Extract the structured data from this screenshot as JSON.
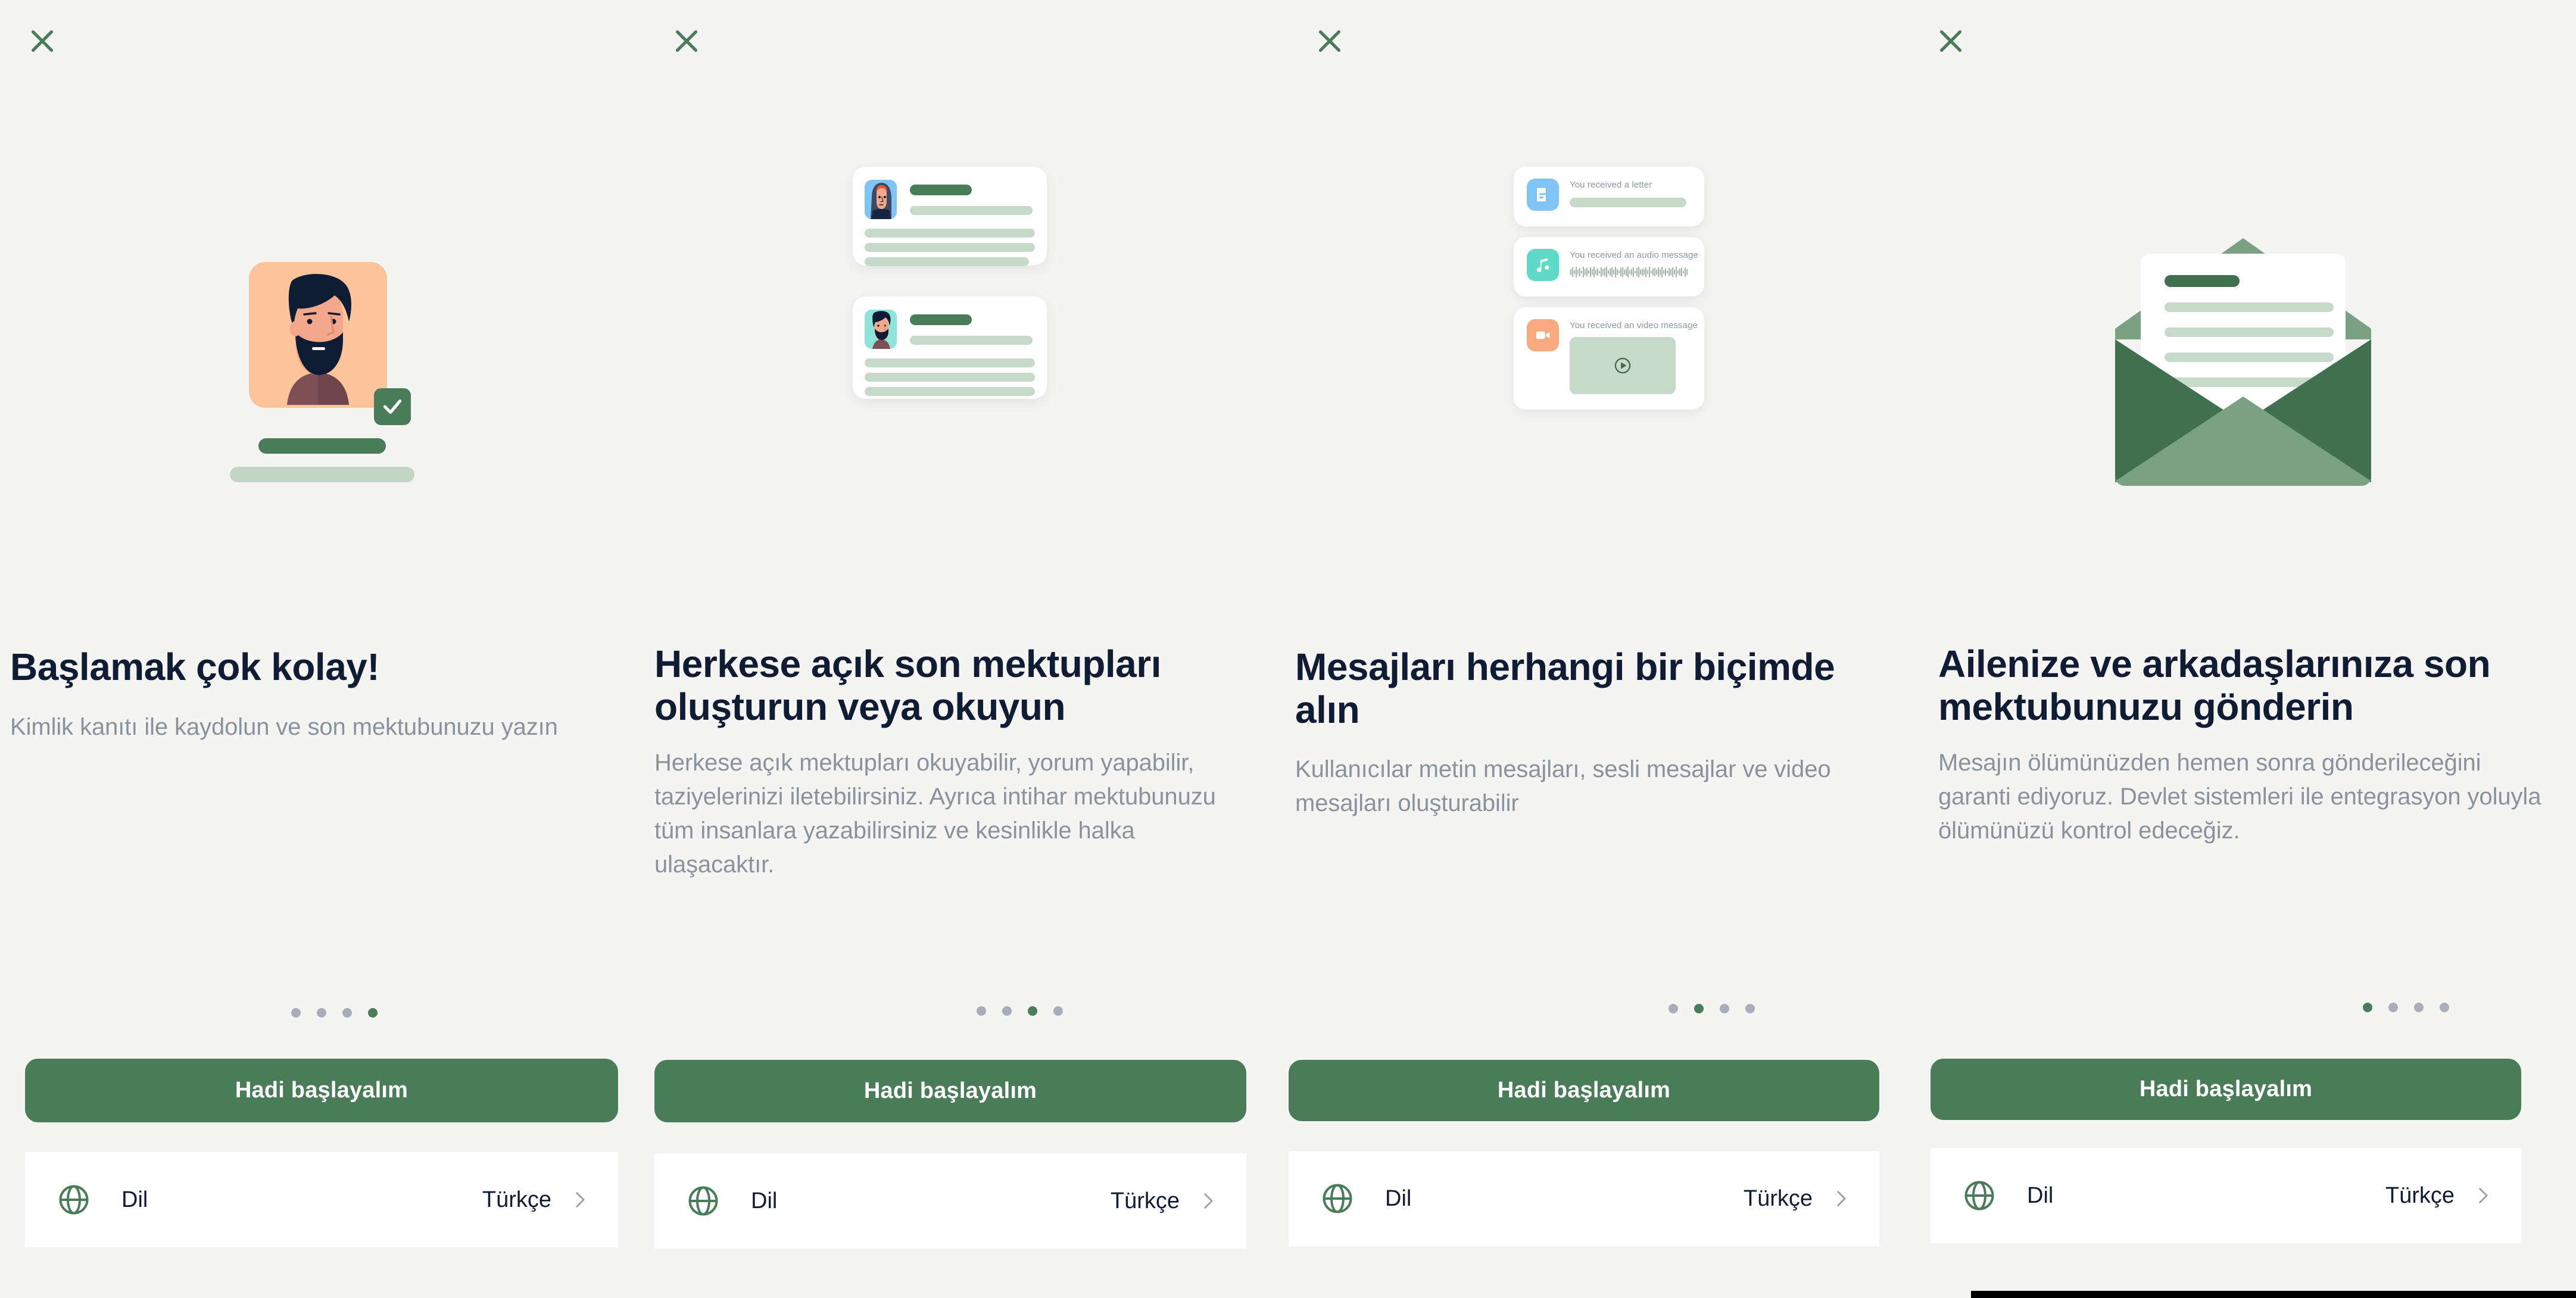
{
  "colors": {
    "background": "#f4f4f3",
    "brand_green": "#4a7c59",
    "title_navy": "#0f1c34",
    "subtitle_gray": "#8a929c",
    "dot_inactive": "#a8adbb",
    "card_white": "#ffffff",
    "placeholder_green": "#c7dac9",
    "avatar_peach": "#fbc49a",
    "avatar_blue": "#7fc4f5",
    "avatar_teal": "#8fe3d8",
    "icon_letter_blue": "#7fc4f5",
    "icon_audio_teal": "#5fd9c8",
    "icon_video_orange": "#f8a97e"
  },
  "common": {
    "close_icon": "close-icon",
    "cta_label": "Hadi başlayalım",
    "language_icon": "globe-icon",
    "language_label": "Dil",
    "language_value": "Türkçe",
    "chevron_icon": "chevron-right-icon",
    "dot_count": 4
  },
  "panels": [
    {
      "id": "panel-1-identity",
      "title": "Başlamak çok kolay!",
      "subtitle": "Kimlik kanıtı ile kaydolun ve son mektubunuzu yazın",
      "active_dot": 3,
      "illustration": "profile-verified-illustration"
    },
    {
      "id": "panel-2-public-letters",
      "title": "Herkese açık son mektupları oluşturun veya okuyun",
      "subtitle": "Herkese açık mektupları okuyabilir, yorum yapabilir, taziyelerinizi iletebilirsiniz. Ayrıca intihar mektubunuzu tüm insanlara yazabilirsiniz ve kesinlikle halka ulaşacaktır.",
      "active_dot": 2,
      "illustration": "letter-cards-illustration",
      "cards": [
        {
          "avatar": "woman-hijab-avatar",
          "avatar_bg": "#7fc4f5",
          "lines": 4
        },
        {
          "avatar": "bearded-man-avatar",
          "avatar_bg": "#8fe3d8",
          "lines": 4
        }
      ]
    },
    {
      "id": "panel-3-message-formats",
      "title": "Mesajları herhangi bir biçimde alın",
      "subtitle": "Kullanıcılar metin mesajları, sesli mesajlar ve video mesajları oluşturabilir",
      "active_dot": 1,
      "illustration": "message-format-cards-illustration",
      "messages": [
        {
          "icon": "document-icon",
          "icon_bg": "#7fc4f5",
          "label": "You received a letter",
          "body": "text-placeholder-bar"
        },
        {
          "icon": "music-note-icon",
          "icon_bg": "#5fd9c8",
          "label": "You received an audio message",
          "body": "audio-waveform"
        },
        {
          "icon": "video-camera-icon",
          "icon_bg": "#f8a97e",
          "label": "You received an video message",
          "body": "video-thumbnail-with-play"
        }
      ]
    },
    {
      "id": "panel-4-delivery",
      "title": "Ailenize ve arkadaşlarınıza son mektubunuzu gönderin",
      "subtitle": "Mesajın ölümünüzden hemen sonra gönderileceğini garanti ediyoruz. Devlet sistemleri ile entegrasyon yoluyla ölümünüzü kontrol edeceğiz.",
      "active_dot": 0,
      "illustration": "open-envelope-letter-illustration"
    }
  ]
}
